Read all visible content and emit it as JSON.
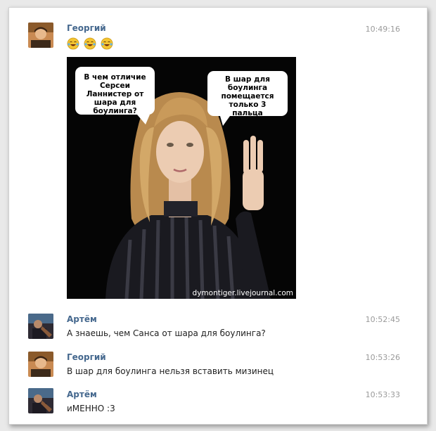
{
  "messages": [
    {
      "author": "Георгий",
      "time": "10:49:16",
      "emojis": [
        "tears-of-joy-emoji",
        "tears-of-joy-emoji",
        "tears-of-joy-emoji"
      ],
      "photo": {
        "bubble_left": "В чем отличие Серсеи Ланнистер от шара для боулинга?",
        "bubble_right": "В шар для боулинга помещается только 3 пальца",
        "watermark": "dymontiger.livejournal.com"
      }
    },
    {
      "author": "Артём",
      "time": "10:52:45",
      "text": "А знаешь, чем Санса от шара для боулинга?"
    },
    {
      "author": "Георгий",
      "time": "10:53:26",
      "text": "В шар для боулинга нельзя вставить мизинец"
    },
    {
      "author": "Артём",
      "time": "10:53:33",
      "text": "иМЕННО :3"
    }
  ],
  "colors": {
    "author": "#45688e",
    "time": "#9a9a9a",
    "text": "#1e1e1e",
    "emoji": "#f4c430"
  }
}
